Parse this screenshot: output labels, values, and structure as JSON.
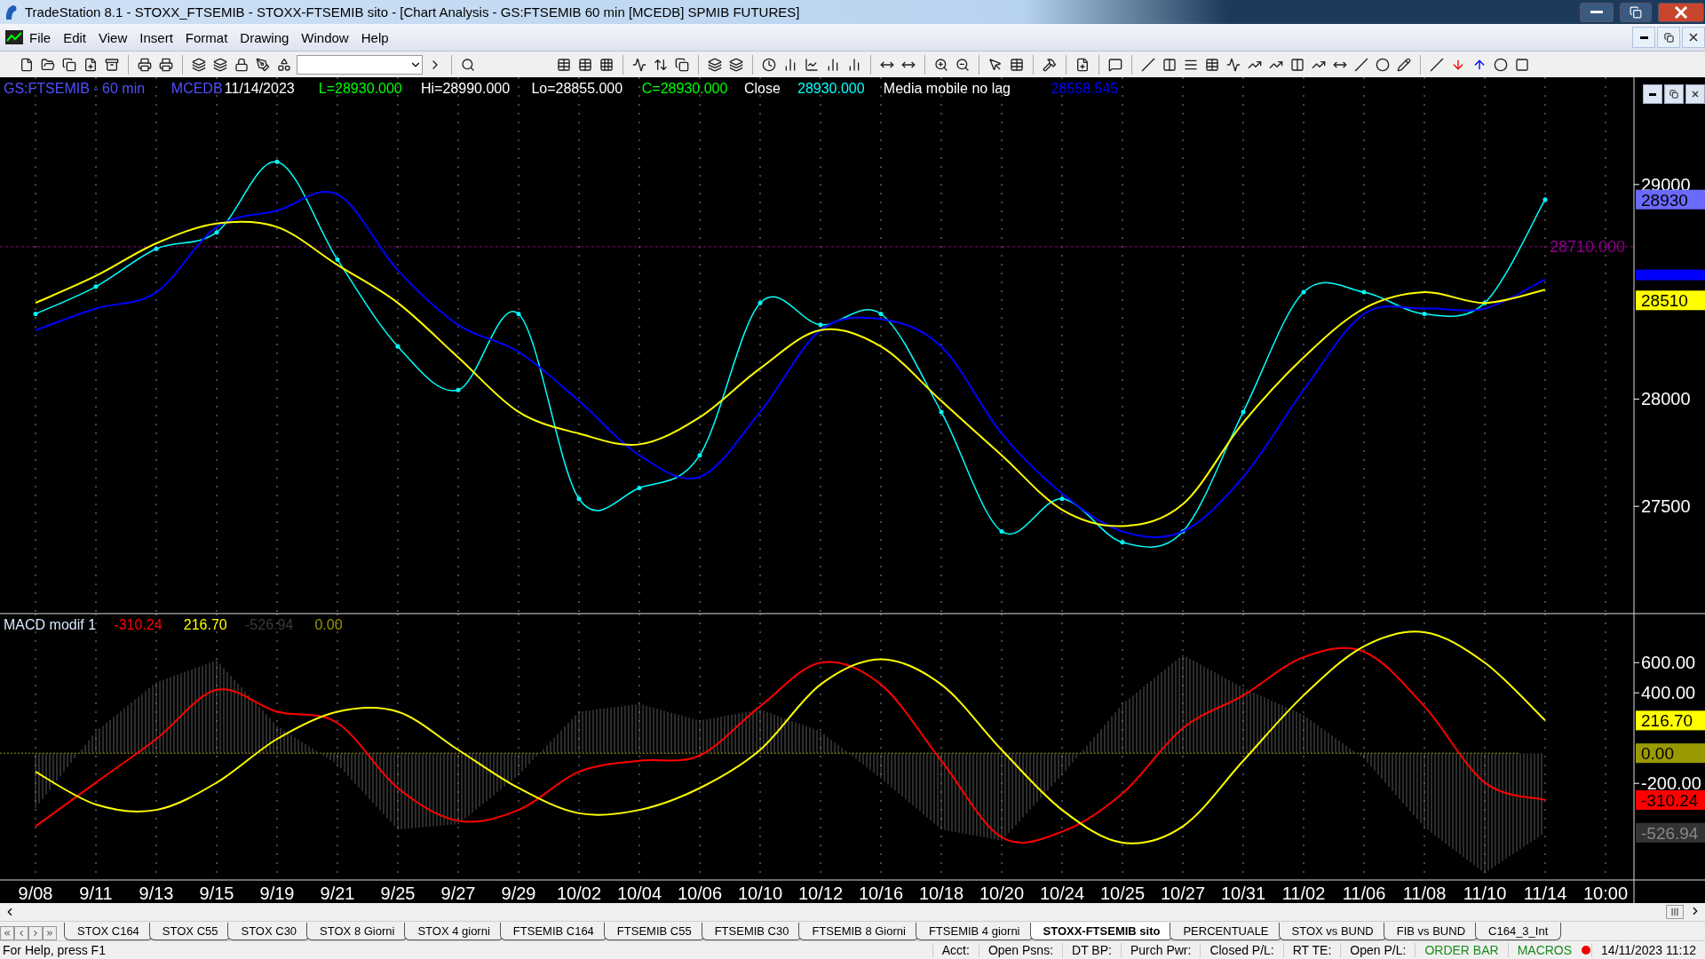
{
  "window": {
    "title": "TradeStation 8.1 - STOXX_FTSEMIB - STOXX-FTSEMIB sito - [Chart Analysis - GS:FTSEMIB  60 min  [MCEDB] SPMIB FUTURES]"
  },
  "menu": [
    "File",
    "Edit",
    "View",
    "Insert",
    "Format",
    "Drawing",
    "Window",
    "Help"
  ],
  "price_panel": {
    "legend": [
      {
        "text": "GS:FTSEMIB - 60 min",
        "color": "#5050ff"
      },
      {
        "text": "MCEDB",
        "color": "#5050ff"
      },
      {
        "text": "11/14/2023",
        "color": "#ffffff"
      },
      {
        "text": "L=28930.000",
        "color": "#00ff00"
      },
      {
        "text": "Hi=28990.000",
        "color": "#ffffff"
      },
      {
        "text": "Lo=28855.000",
        "color": "#ffffff"
      },
      {
        "text": "C=28930.000",
        "color": "#00ff00"
      },
      {
        "text": "Close",
        "color": "#ffffff"
      },
      {
        "text": "28930.000",
        "color": "#00ffff"
      },
      {
        "text": "Media mobile no lag",
        "color": "#ffffff"
      },
      {
        "text": "28558.545",
        "color": "#0000ff"
      }
    ],
    "axis_markers": [
      {
        "text": "28930",
        "color": "#6a6aff"
      },
      {
        "text": "28510",
        "color": "#ffff00"
      }
    ],
    "hidden_marker": {
      "color": "#0000ff"
    },
    "level_line": {
      "text": "28710.000",
      "color": "#8b008b"
    },
    "chart_data": {
      "type": "line",
      "grid": true,
      "ylim": [
        27000,
        29500
      ],
      "yticks": [
        27500,
        28000,
        29000
      ],
      "series": [
        {
          "color": "#00ffff",
          "values": [
            28397,
            28524,
            28700,
            28777,
            29106,
            28650,
            28245,
            28042,
            28397,
            27535,
            27586,
            27738,
            28448,
            28346,
            28397,
            27940,
            27383,
            27535,
            27332,
            27383,
            27940,
            28498,
            28498,
            28397,
            28448,
            28930,
            null
          ]
        },
        {
          "color": "#0000ff",
          "values": [
            28321,
            28422,
            28498,
            28802,
            28878,
            28954,
            28600,
            28346,
            28220,
            27991,
            27738,
            27637,
            27940,
            28321,
            28372,
            28245,
            27839,
            27560,
            27383,
            27383,
            27637,
            28042,
            28397,
            28422,
            28422,
            28558,
            null
          ]
        },
        {
          "color": "#ffff00",
          "values": [
            28448,
            28574,
            28726,
            28818,
            28802,
            28625,
            28448,
            28194,
            27940,
            27839,
            27789,
            27915,
            28143,
            28321,
            28245,
            27991,
            27738,
            27484,
            27408,
            27510,
            27890,
            28194,
            28422,
            28498,
            28448,
            28510,
            null
          ]
        }
      ]
    }
  },
  "macd_panel": {
    "legend": [
      {
        "text": "MACD modif 1",
        "color": "#d8e8ff"
      },
      {
        "text": "-310.24",
        "color": "#ff0000"
      },
      {
        "text": "216.70",
        "color": "#ffff00"
      },
      {
        "text": "-526.94",
        "color": "#3a3a3a"
      },
      {
        "text": "0.00",
        "color": "#999900"
      }
    ],
    "axis_markers": [
      {
        "text": "216.70",
        "color": "#ffff00"
      },
      {
        "text": "0.00",
        "color": "#999900"
      },
      {
        "text": "-310.24",
        "color": "#ff0000"
      },
      {
        "text": "-526.94",
        "color": "#333333"
      }
    ],
    "chart_data": {
      "type": "line",
      "grid": true,
      "categories": [
        "9/08",
        "9/11",
        "9/13",
        "9/15",
        "9/19",
        "9/21",
        "9/25",
        "9/27",
        "9/29",
        "10/02",
        "10/04",
        "10/06",
        "10/10",
        "10/12",
        "10/16",
        "10/18",
        "10/20",
        "10/24",
        "10/25",
        "10/27",
        "10/31",
        "11/02",
        "11/06",
        "11/08",
        "11/10",
        "11/14",
        "10:00"
      ],
      "ylim": [
        -840,
        925
      ],
      "yticks": [
        {
          "value": -200,
          "label": "-200.00"
        },
        {
          "value": 400,
          "label": "400.00"
        },
        {
          "value": 600,
          "label": "600.00"
        }
      ],
      "series": [
        {
          "color": "#ff0000",
          "values": [
            -485,
            -195,
            94,
            420,
            275,
            200,
            -231,
            -448,
            -376,
            -123,
            -50,
            -15,
            311,
            600,
            455,
            -50,
            -557,
            -520,
            -267,
            166,
            383,
            636,
            672,
            311,
            -195,
            -310,
            null
          ]
        },
        {
          "color": "#ffff00",
          "values": [
            -123,
            -340,
            -376,
            -195,
            94,
            275,
            275,
            22,
            -231,
            -398,
            -376,
            -231,
            22,
            455,
            622,
            455,
            22,
            -376,
            -593,
            -485,
            -50,
            383,
            708,
            802,
            600,
            217,
            null
          ]
        }
      ]
    }
  },
  "sheet_tabs": [
    {
      "label": "STOX C164",
      "selected": false
    },
    {
      "label": "STOX C55",
      "selected": false
    },
    {
      "label": "STOX  C30",
      "selected": false
    },
    {
      "label": "STOX  8 Giorni",
      "selected": false
    },
    {
      "label": "STOX 4 giorni",
      "selected": false
    },
    {
      "label": "FTSEMIB C164",
      "selected": false
    },
    {
      "label": "FTSEMIB C55",
      "selected": false
    },
    {
      "label": "FTSEMIB C30",
      "selected": false
    },
    {
      "label": "FTSEMIB  8 Giorni",
      "selected": false
    },
    {
      "label": "FTSEMIB  4 giorni",
      "selected": false
    },
    {
      "label": "STOXX-FTSEMIB sito",
      "selected": true
    },
    {
      "label": "PERCENTUALE",
      "selected": false
    },
    {
      "label": "STOX vs BUND",
      "selected": false
    },
    {
      "label": "FIB vs BUND",
      "selected": false
    },
    {
      "label": "C164_3_Int",
      "selected": false
    }
  ],
  "status_bar": {
    "help": "For Help, press F1",
    "fields": [
      "Acct:",
      "Open Psns:",
      "DT BP:",
      "Purch Pwr:",
      "Closed P/L:",
      "RT TE:",
      "Open P/L:"
    ],
    "links": [
      "ORDER BAR",
      "MACROS"
    ],
    "datetime": "14/11/2023 11:12"
  }
}
